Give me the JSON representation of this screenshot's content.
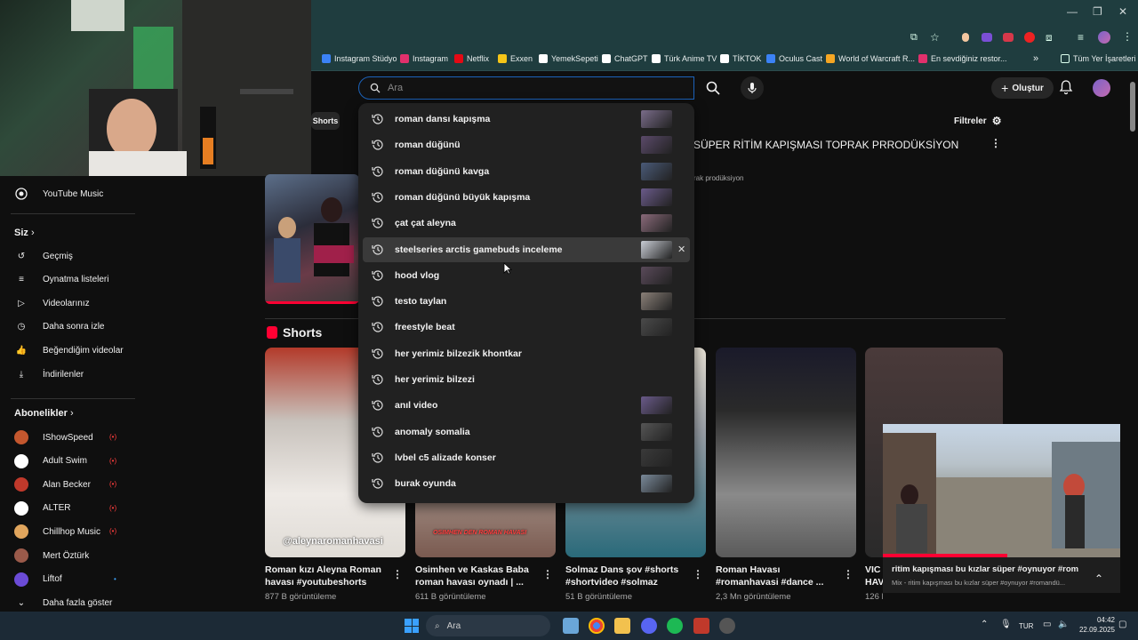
{
  "bookmarks": [
    {
      "label": "Instagram Stüdyo",
      "color": "#3b82f6"
    },
    {
      "label": "Instagram",
      "color": "#e1306c"
    },
    {
      "label": "Netflix",
      "color": "#e50914"
    },
    {
      "label": "Exxen",
      "color": "#f5c518"
    },
    {
      "label": "YemekSepeti",
      "color": "#ffffff"
    },
    {
      "label": "ChatGPT",
      "color": "#ffffff"
    },
    {
      "label": "Türk Anime TV",
      "color": "#ffffff"
    },
    {
      "label": "TİKTOK",
      "color": "#ffffff"
    },
    {
      "label": "Oculus Cast",
      "color": "#3b82f6"
    },
    {
      "label": "World of Warcraft R...",
      "color": "#f5a623"
    },
    {
      "label": "En sevdiğiniz restor...",
      "color": "#e1306c"
    }
  ],
  "bookmarks_overflow": "»",
  "all_bookmarks": "Tüm Yer İşaretleri",
  "search": {
    "placeholder": "Ara"
  },
  "header": {
    "create_label": "Oluştur"
  },
  "chips": {
    "shorts": "Shorts"
  },
  "filters_label": "Filtreler",
  "video": {
    "title": "SÜPER RİTİM KAPIŞMASI TOPRAK PRRODÜKSİYON",
    "channel": "rak prodüksiyon"
  },
  "sidebar": {
    "top_item": "YouTube Music",
    "you_section": "Siz",
    "you_items": [
      "Geçmiş",
      "Oynatma listeleri",
      "Videolarınız",
      "Daha sonra izle",
      "Beğendiğim videolar",
      "İndirilenler"
    ],
    "subs_section": "Abonelikler",
    "subscriptions": [
      {
        "name": "IShowSpeed",
        "live": true,
        "color": "#c4572e"
      },
      {
        "name": "Adult Swim",
        "live": true,
        "color": "#ffffff"
      },
      {
        "name": "Alan Becker",
        "live": true,
        "color": "#c0392b"
      },
      {
        "name": "ALTER",
        "live": true,
        "color": "#ffffff"
      },
      {
        "name": "Chillhop Music",
        "live": true,
        "color": "#e0a55d"
      },
      {
        "name": "Mert Öztürk",
        "live": false,
        "color": "#9a5a4a"
      },
      {
        "name": "Liftof",
        "live": false,
        "color": "#6b4bd6"
      }
    ],
    "show_more": "Daha fazla göster"
  },
  "suggestions": [
    {
      "text": "roman dansı kapışma",
      "thumb": true
    },
    {
      "text": "roman düğünü",
      "thumb": true
    },
    {
      "text": "roman düğünü kavga",
      "thumb": true
    },
    {
      "text": "roman düğünü büyük kapışma",
      "thumb": true
    },
    {
      "text": "çat çat aleyna",
      "thumb": true
    },
    {
      "text": "steelseries arctis gamebuds inceleme",
      "thumb": true,
      "highlight": true
    },
    {
      "text": "hood vlog",
      "thumb": true
    },
    {
      "text": "testo taylan",
      "thumb": true
    },
    {
      "text": "freestyle beat",
      "thumb": true
    },
    {
      "text": "her yerimiz bilzezik khontkar",
      "thumb": false
    },
    {
      "text": "her yerimiz bilzezi",
      "thumb": false
    },
    {
      "text": "anıl video",
      "thumb": true
    },
    {
      "text": "anomaly somalia",
      "thumb": true
    },
    {
      "text": "lvbel c5 alizade konser",
      "thumb": true
    },
    {
      "text": "burak oyunda",
      "thumb": true
    }
  ],
  "shorts_header": "Shorts",
  "shorts": [
    {
      "title1": "Roman kızı Aleyna Roman",
      "title2": "havası #youtubeshorts",
      "views": "877 B görüntüleme",
      "overlay": "@aleynaromanhavasi"
    },
    {
      "title1": "Osimhen ve Kaskas Baba",
      "title2": "roman havası oynadı | ...",
      "views": "611 B görüntüleme",
      "overlay": "OSIMHEN DEN ROMAN HAVASI"
    },
    {
      "title1": "Solmaz Dans şov #shorts",
      "title2": "#shortvideo #solmaz",
      "views": "51 B görüntüleme",
      "overlay": ""
    },
    {
      "title1": "Roman Havası",
      "title2": "#romanhavasi #dance ...",
      "views": "2,3 Mn görüntüleme",
      "overlay": ""
    },
    {
      "title1": "VIC",
      "title2": "HAV",
      "views": "126 B",
      "overlay": ""
    }
  ],
  "miniplayer": {
    "title": "ritim kapışması bu kızlar süper #oynuyor #roma...",
    "subtitle": "Mix - ritim kapışması bu kızlar süper #oynuyor #romandü..."
  },
  "taskbar": {
    "search": "Ara",
    "lang": "TUR",
    "time": "04:42",
    "date": "22.09.2025"
  }
}
